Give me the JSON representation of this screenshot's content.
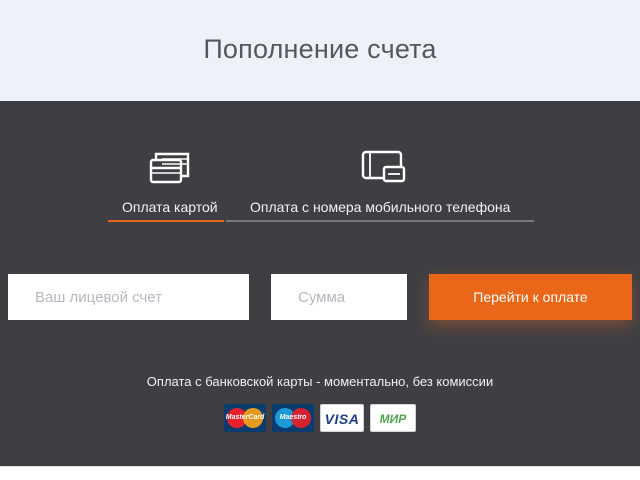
{
  "header": {
    "title": "Пополнение счета"
  },
  "tabs": [
    {
      "id": "card",
      "label": "Оплата картой",
      "icon": "credit-cards-icon",
      "active": true
    },
    {
      "id": "phone",
      "label": "Оплата с номера мобильного телефона",
      "icon": "mobile-phone-icon",
      "active": false
    }
  ],
  "form": {
    "account_placeholder": "Ваш лицевой счет",
    "amount_placeholder": "Сумма",
    "submit_label": "Перейти к оплате"
  },
  "note": "Оплата с банковской карты - моментально, без комиссии",
  "payment_systems": [
    {
      "name": "mastercard-logo",
      "text": "MasterCard"
    },
    {
      "name": "maestro-logo",
      "text": "Maestro"
    },
    {
      "name": "visa-logo",
      "text": "VISA"
    },
    {
      "name": "mir-logo",
      "text": "МИР"
    }
  ],
  "colors": {
    "accent": "#ea6619",
    "panel": "#3f3f43",
    "header_bg": "#eef1f7",
    "title": "#55585d"
  }
}
